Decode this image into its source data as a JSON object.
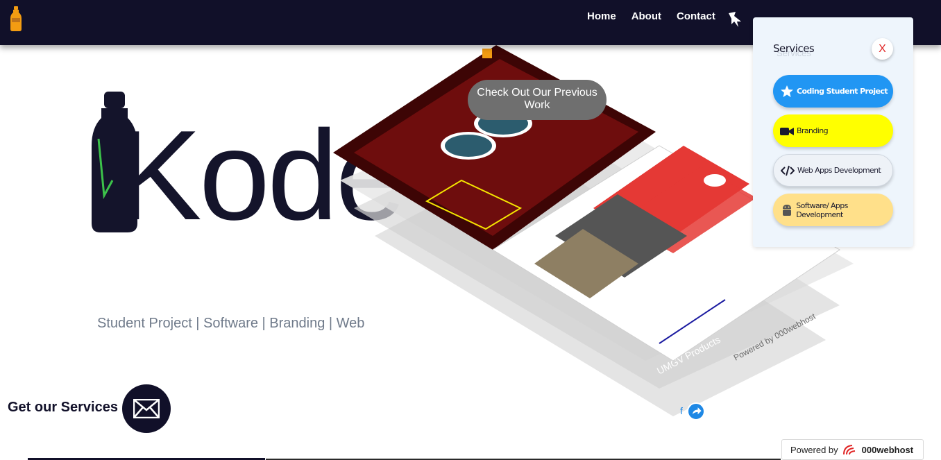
{
  "nav": {
    "links": [
      "Home",
      "About",
      "Contact"
    ]
  },
  "hero": {
    "brand_text": "Kode",
    "tagline": "Student Project | Software | Branding | Web"
  },
  "showcase": {
    "callout": "Check Out Our Previous Work"
  },
  "services_panel": {
    "title": "Services",
    "title_ghost": "Services",
    "close_label": "X",
    "items": [
      {
        "label": "Coding Student Project",
        "icon": "star-icon"
      },
      {
        "label": "Branding",
        "icon": "video-camera-icon"
      },
      {
        "label": "Web Apps Development",
        "icon": "code-icon"
      },
      {
        "label": "Software/ Apps Development",
        "icon": "android-icon"
      }
    ]
  },
  "cta": {
    "label": "Get our Services",
    "icon": "envelope-icon"
  },
  "footer": {
    "powered_by": "Powered by",
    "brand": "000webhost"
  },
  "colors": {
    "navbar": "#111029",
    "accent_blue": "#2196f3",
    "accent_yellow": "#ffff00",
    "accent_orange": "#f39c12",
    "close_red": "#e02424"
  }
}
